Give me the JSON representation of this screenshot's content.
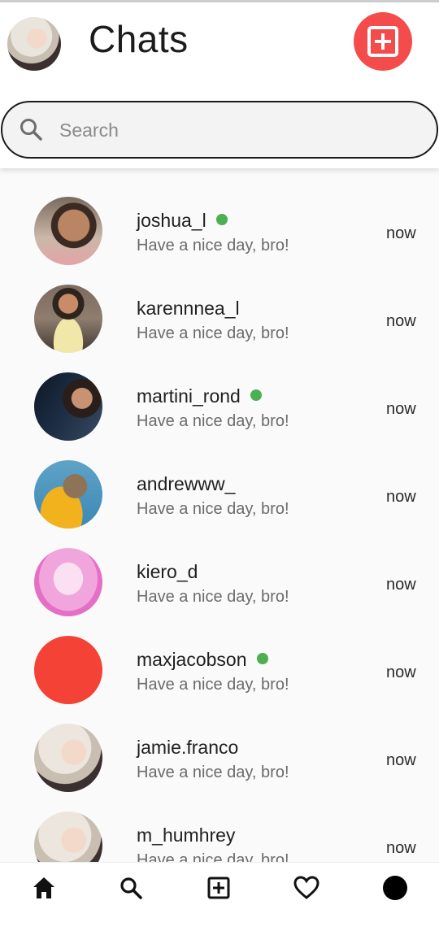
{
  "header": {
    "title": "Chats",
    "profile_avatar": "user-profile-photo",
    "compose_icon": "plus-square-icon"
  },
  "search": {
    "placeholder": "Search",
    "icon": "search-icon"
  },
  "chats": [
    {
      "name": "joshua_l",
      "message": "Have a nice day, bro!",
      "time": "now",
      "online": true
    },
    {
      "name": "karennnea_l",
      "message": "Have a nice day, bro!",
      "time": "now",
      "online": false
    },
    {
      "name": "martini_rond",
      "message": "Have a nice day, bro!",
      "time": "now",
      "online": true
    },
    {
      "name": "andrewww_",
      "message": "Have a nice day, bro!",
      "time": "now",
      "online": false
    },
    {
      "name": "kiero_d",
      "message": "Have a nice day, bro!",
      "time": "now",
      "online": false
    },
    {
      "name": "maxjacobson",
      "message": "Have a nice day, bro!",
      "time": "now",
      "online": true
    },
    {
      "name": "jamie.franco",
      "message": "Have a nice day, bro!",
      "time": "now",
      "online": false
    },
    {
      "name": "m_humhrey",
      "message": "Have a nice day, bro!",
      "time": "now",
      "online": false
    }
  ],
  "bottom_nav": [
    {
      "icon": "home-icon"
    },
    {
      "icon": "search-icon"
    },
    {
      "icon": "plus-square-icon"
    },
    {
      "icon": "heart-icon"
    },
    {
      "icon": "profile-dot-icon"
    }
  ],
  "colors": {
    "accent": "#f44b4b",
    "online": "#4caf50",
    "background": "#fafafa"
  }
}
